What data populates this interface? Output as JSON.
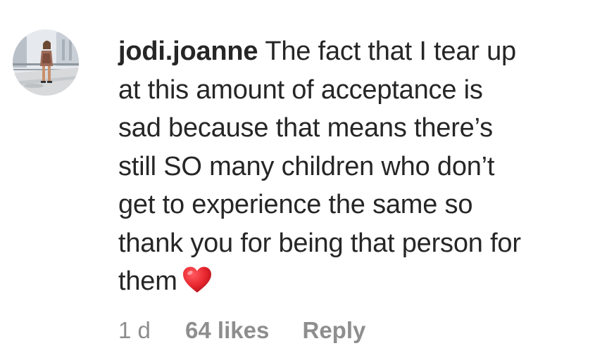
{
  "comment": {
    "username": "jodi.joanne",
    "lines": [
      "The fact that I tear up",
      "at this amount of acceptance is",
      "sad because that means there’s",
      "still SO many children who don’t",
      "get to experience the same so",
      "thank you for being that person for",
      "them"
    ],
    "emoji": "red-heart-icon",
    "time": "1 d",
    "likes": "64 likes",
    "reply_label": "Reply"
  },
  "colors": {
    "text": "#262626",
    "meta": "#8e8e8e",
    "heart": "#e8262f"
  }
}
